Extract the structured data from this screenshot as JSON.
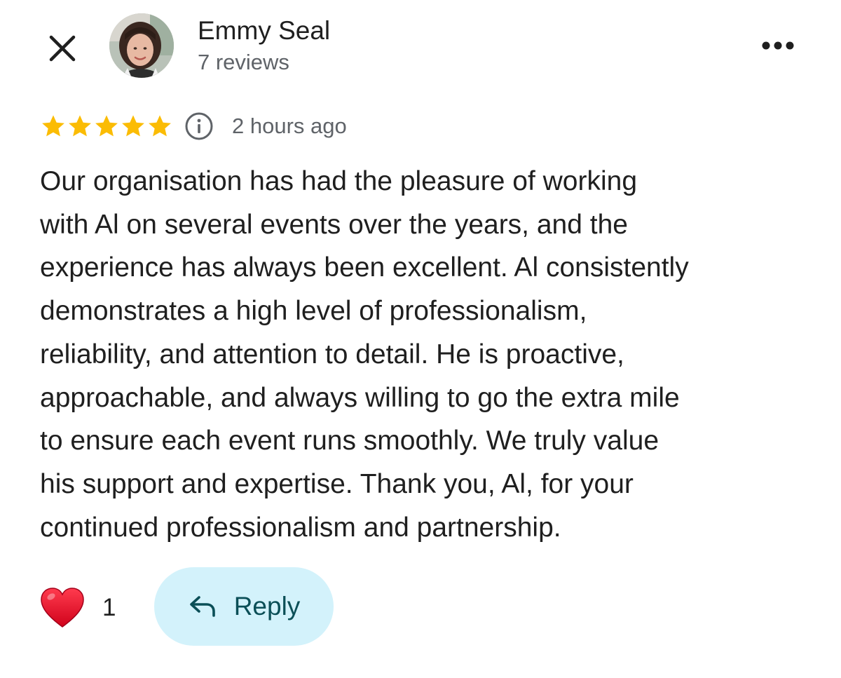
{
  "header": {
    "close_icon": "close-icon",
    "more_icon": "more-horizontal-icon"
  },
  "reviewer": {
    "name": "Emmy Seal",
    "review_count": "7 reviews"
  },
  "rating": {
    "stars": 5,
    "max_stars": 5,
    "star_color": "#fbbc04",
    "info_icon": "info-icon",
    "timestamp": "2 hours ago"
  },
  "review": {
    "lines": [
      "Our organisation has had the pleasure of working",
      "with Al on several events over the years, and the",
      "experience has always been excellent. Al consistently",
      "demonstrates a high level of professionalism,",
      "reliability, and attention to detail. He is proactive,",
      "approachable, and always willing to go the extra mile",
      "to ensure each event runs smoothly. We truly value",
      "his support and expertise. Thank you, Al, for your",
      "continued professionalism and partnership."
    ]
  },
  "actions": {
    "like_icon": "heart-icon",
    "like_count": "1",
    "reply_icon": "reply-arrow-icon",
    "reply_label": "Reply",
    "reply_bg_color": "#d3f2fb",
    "reply_text_color": "#0b4f57",
    "heart_color": "#e0102c"
  }
}
